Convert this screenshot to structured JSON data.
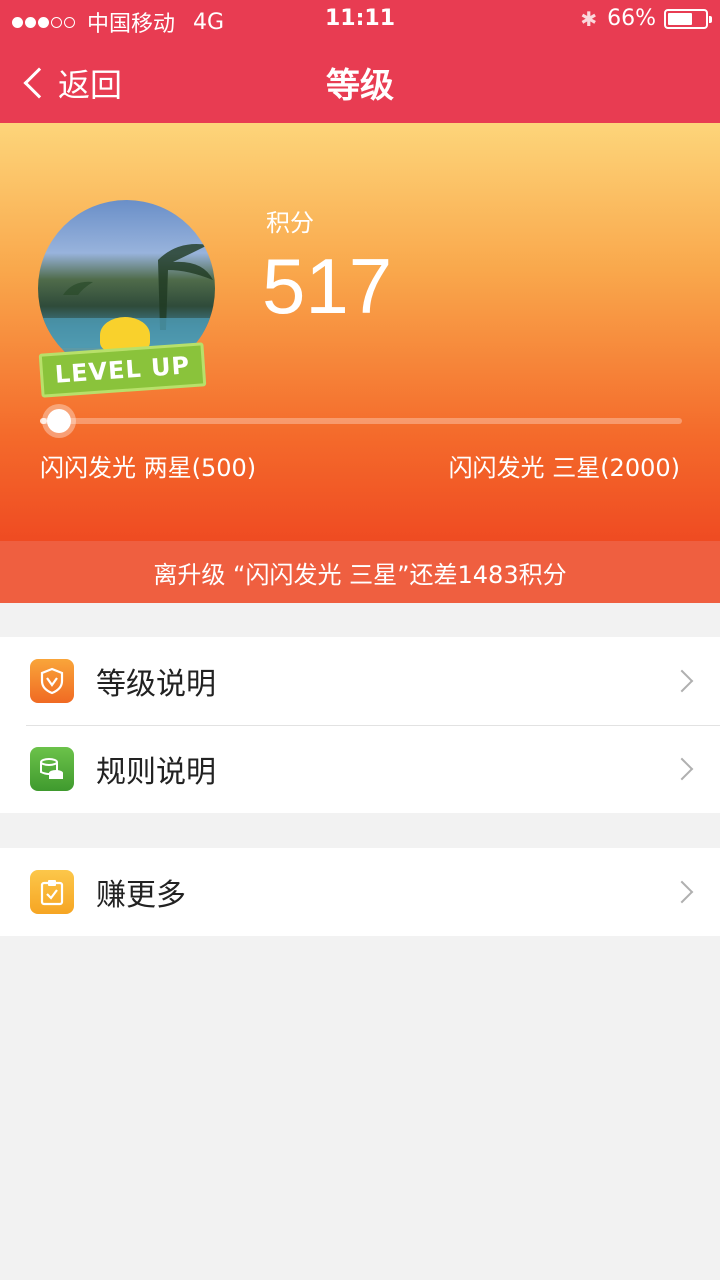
{
  "status_bar": {
    "carrier": "中国移动",
    "network": "4G",
    "time": "11:11",
    "battery": "66%",
    "battery_level": 0.66,
    "bluetooth_icon": "bluetooth-icon"
  },
  "nav": {
    "back_label": "返回",
    "title": "等级"
  },
  "hero": {
    "score_label": "积分",
    "score": "517",
    "badge_text": "LEVEL UP",
    "current_level": "闪闪发光 两星(500)",
    "next_level": "闪闪发光 三星(2000)",
    "progress": 0.011
  },
  "banner": {
    "text": "离升级 “闪闪发光 三星”还差1483积分"
  },
  "menu_group_1": [
    {
      "label": "等级说明",
      "icon": "shield-icon"
    },
    {
      "label": "规则说明",
      "icon": "coins-icon"
    }
  ],
  "menu_group_2": [
    {
      "label": "赚更多",
      "icon": "clipboard-check-icon"
    }
  ],
  "colors": {
    "header": "#e83c52",
    "hero_top": "#fdd57a",
    "hero_bottom": "#ef4b22",
    "banner": "#ef5f40"
  }
}
